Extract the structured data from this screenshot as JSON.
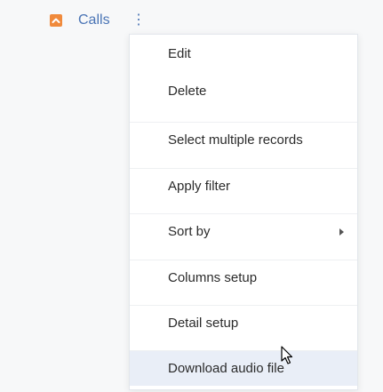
{
  "header": {
    "section_label": "Calls",
    "section_icon": "collapse-chevron-icon",
    "accent_color": "#4a74b5",
    "icon_color": "#f08a3c"
  },
  "menu": {
    "items": [
      {
        "label": "Edit"
      },
      {
        "label": "Delete"
      },
      {
        "label": "Select multiple records"
      },
      {
        "label": "Apply filter"
      },
      {
        "label": "Sort by",
        "has_submenu": true
      },
      {
        "label": "Columns setup"
      },
      {
        "label": "Detail setup"
      },
      {
        "label": "Download audio file",
        "hovered": true
      }
    ],
    "hover_color": "#e9eef7"
  }
}
